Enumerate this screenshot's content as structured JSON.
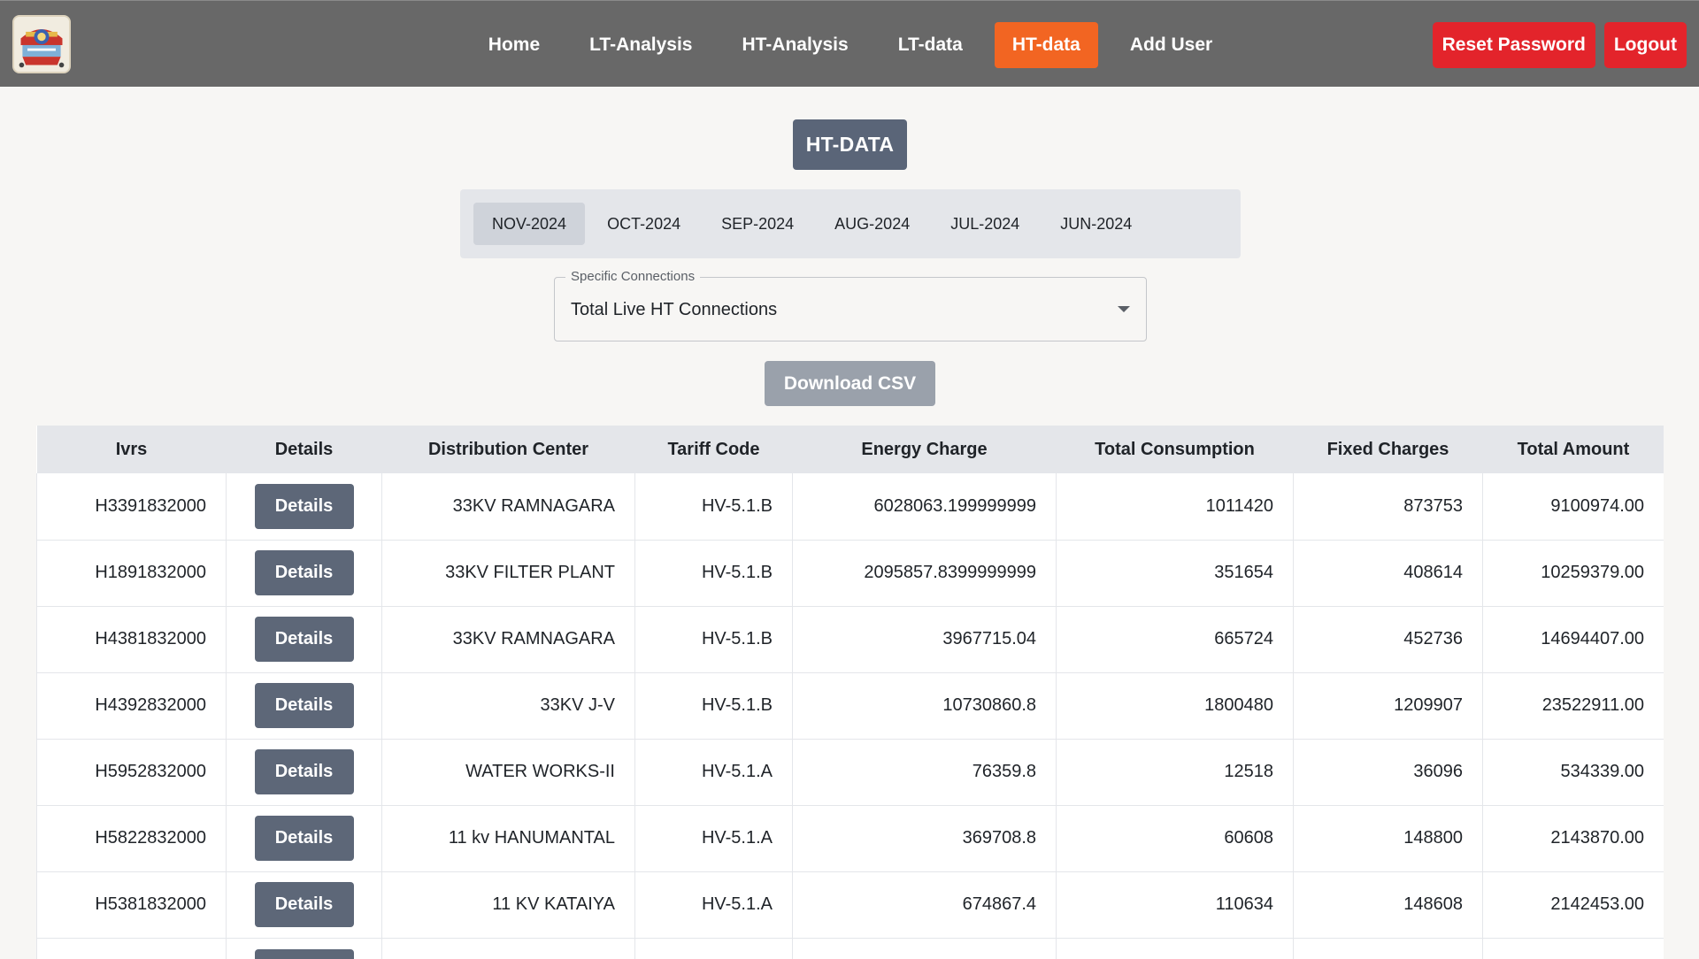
{
  "nav": {
    "items": [
      {
        "label": "Home",
        "active": false
      },
      {
        "label": "LT-Analysis",
        "active": false
      },
      {
        "label": "HT-Analysis",
        "active": false
      },
      {
        "label": "LT-data",
        "active": false
      },
      {
        "label": "HT-data",
        "active": true
      },
      {
        "label": "Add User",
        "active": false
      }
    ],
    "reset_password_label": "Reset Password",
    "logout_label": "Logout"
  },
  "page": {
    "title": "HT-DATA"
  },
  "months": {
    "tabs": [
      "NOV-2024",
      "OCT-2024",
      "SEP-2024",
      "AUG-2024",
      "JUL-2024",
      "JUN-2024"
    ],
    "active": "NOV-2024"
  },
  "filter": {
    "legend": "Specific Connections",
    "value": "Total Live HT Connections"
  },
  "download_label": "Download CSV",
  "table": {
    "columns": [
      "Ivrs",
      "Details",
      "Distribution Center",
      "Tariff Code",
      "Energy Charge",
      "Total Consumption",
      "Fixed Charges",
      "Total Amount"
    ],
    "details_label": "Details",
    "rows": [
      {
        "ivrs": "H3391832000",
        "dc": "33KV RAMNAGARA",
        "tariff": "HV-5.1.B",
        "energy": "6028063.199999999",
        "consumption": "1011420",
        "fixed": "873753",
        "amount": "9100974.00"
      },
      {
        "ivrs": "H1891832000",
        "dc": "33KV FILTER PLANT",
        "tariff": "HV-5.1.B",
        "energy": "2095857.8399999999",
        "consumption": "351654",
        "fixed": "408614",
        "amount": "10259379.00"
      },
      {
        "ivrs": "H4381832000",
        "dc": "33KV RAMNAGARA",
        "tariff": "HV-5.1.B",
        "energy": "3967715.04",
        "consumption": "665724",
        "fixed": "452736",
        "amount": "14694407.00"
      },
      {
        "ivrs": "H4392832000",
        "dc": "33KV J-V",
        "tariff": "HV-5.1.B",
        "energy": "10730860.8",
        "consumption": "1800480",
        "fixed": "1209907",
        "amount": "23522911.00"
      },
      {
        "ivrs": "H5952832000",
        "dc": "WATER WORKS-II",
        "tariff": "HV-5.1.A",
        "energy": "76359.8",
        "consumption": "12518",
        "fixed": "36096",
        "amount": "534339.00"
      },
      {
        "ivrs": "H5822832000",
        "dc": "11 kv HANUMANTAL",
        "tariff": "HV-5.1.A",
        "energy": "369708.8",
        "consumption": "60608",
        "fixed": "148800",
        "amount": "2143870.00"
      },
      {
        "ivrs": "H5381832000",
        "dc": "11 KV KATAIYA",
        "tariff": "HV-5.1.A",
        "energy": "674867.4",
        "consumption": "110634",
        "fixed": "148608",
        "amount": "2142453.00"
      },
      {
        "ivrs": "",
        "dc": "",
        "tariff": "",
        "energy": "",
        "consumption": "",
        "fixed": "",
        "amount": ""
      }
    ]
  },
  "colors": {
    "nav_bg": "#686868",
    "active_tab": "#f26522",
    "danger": "#e3242b",
    "title_bg": "#5a6578",
    "details_btn": "#5d6778"
  }
}
